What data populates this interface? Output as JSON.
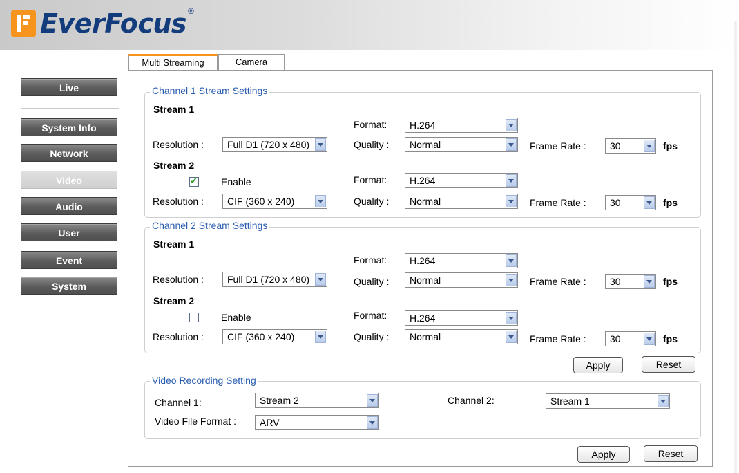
{
  "brand": {
    "name": "EverFocus",
    "registered": "®",
    "accent": "#f7941d",
    "text_color": "#123c7c"
  },
  "sidebar": {
    "items": [
      {
        "label": "Live",
        "active": false
      },
      {
        "label": "System Info",
        "active": false
      },
      {
        "label": "Network",
        "active": false
      },
      {
        "label": "Video",
        "active": true
      },
      {
        "label": "Audio",
        "active": false
      },
      {
        "label": "User",
        "active": false
      },
      {
        "label": "Event",
        "active": false
      },
      {
        "label": "System",
        "active": false
      }
    ]
  },
  "tabs": [
    {
      "label": "Multi Streaming",
      "active": true
    },
    {
      "label": "Camera",
      "active": false
    }
  ],
  "labels": {
    "format": "Format:",
    "resolution": "Resolution :",
    "quality": "Quality :",
    "frame_rate": "Frame Rate :",
    "fps": "fps",
    "enable": "Enable",
    "stream1": "Stream 1",
    "stream2": "Stream 2"
  },
  "channel1": {
    "legend": "Channel 1 Stream Settings",
    "stream1": {
      "format": "H.264",
      "resolution": "Full D1 (720 x 480)",
      "quality": "Normal",
      "frame_rate": "30"
    },
    "stream2": {
      "enabled": true,
      "format": "H.264",
      "resolution": "CIF (360 x 240)",
      "quality": "Normal",
      "frame_rate": "30"
    }
  },
  "channel2": {
    "legend": "Channel 2 Stream Settings",
    "stream1": {
      "format": "H.264",
      "resolution": "Full D1 (720 x 480)",
      "quality": "Normal",
      "frame_rate": "30"
    },
    "stream2": {
      "enabled": false,
      "format": "H.264",
      "resolution": "CIF (360 x 240)",
      "quality": "Normal",
      "frame_rate": "30"
    }
  },
  "actions": {
    "apply": "Apply",
    "reset": "Reset"
  },
  "recording": {
    "legend": "Video Recording Setting",
    "channel1_label": "Channel 1:",
    "channel1_value": "Stream 2",
    "channel2_label": "Channel 2:",
    "channel2_value": "Stream 1",
    "file_format_label": "Video File Format :",
    "file_format_value": "ARV"
  }
}
